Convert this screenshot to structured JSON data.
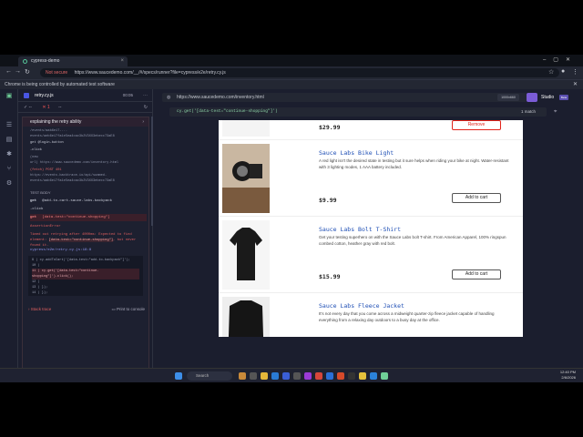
{
  "browser": {
    "tab_title": "cypress-demo",
    "not_secure": "Not secure",
    "url": "https://www.saucedemo.com/__/#/specs/runner?file=cypress/e2e/retry.cy.js",
    "automation_notice": "Chrome is being controlled by automated test software"
  },
  "reporter": {
    "spec_name": "retry.cy.js",
    "duration": "00:05",
    "passed_count": "--",
    "failed_count": "1",
    "pending_count": "--",
    "test_title": "explaining the retry ability",
    "log_lines": [
      "/events/aab6e17-...",
      "events/aeb6e17fa1e5ea4cac3b2V3XX3ebecc73aE8",
      "get   @login-button",
      "-click",
      "(new",
      "url)   https://www.saucedemo.com/inventory.html",
      "(fetch)   POST 401",
      "https://events.backtrace.io/api/summed-",
      "events/aab6e17fa1e5ea4cac3b2V3XX3ebecc73aE8"
    ],
    "test_body_label": "TEST BODY",
    "cmd_get_label": "get",
    "cmd_backpack": "@add-to-cart-sauce-labs-backpack",
    "cmd_click": "-click",
    "cmd_failed": "[data-test=\"continue-shopping\"]",
    "assertion_error": "AssertionError",
    "error_message": "Timed out retrying after 4000ms: Expected to find element:",
    "error_selector": "[data-test=\"continue-shopping\"]",
    "error_tail": ", but never found it.",
    "file_ref": "cypress/e2e/retry.cy.js:18:8",
    "code_lines": [
      "9  |      cy.addToCart('[data-test=\"add-to-backpack\"]');",
      "10 |",
      "11 |      cy.get('[data-test=\"continue-shopping\"]').click();",
      "12 |",
      "13 |    });",
      "14 |  });",
      "15 |"
    ],
    "stack_trace": "Stack trace",
    "print_console": "Print to console"
  },
  "aut": {
    "url": "https://www.saucedemo.com/inventory.html",
    "viewport": "1000x660",
    "studio": "Studio",
    "beta": "Beta",
    "selector": "cy.get('[data-test=\"continue-shopping\"]')",
    "match": "1 match"
  },
  "products": [
    {
      "name": "",
      "desc": "",
      "price": "$29.99",
      "button": "Remove"
    },
    {
      "name": "Sauce Labs Bike Light",
      "desc": "A red light isn't the desired state in testing but it sure helps when riding your bike at night. Water-resistant with 3 lighting modes, 1 AAA battery included.",
      "price": "$9.99",
      "button": "Add to cart"
    },
    {
      "name": "Sauce Labs Bolt T-Shirt",
      "desc": "Get your testing superhero on with the Sauce Labs bolt T-shirt. From American Apparel, 100% ringspun combed cotton, heather gray with red bolt.",
      "price": "$15.99",
      "button": "Add to cart"
    },
    {
      "name": "Sauce Labs Fleece Jacket",
      "desc": "It's not every day that you come across a midweight quarter-zip fleece jacket capable of handling everything from a relaxing day outdoors to a busy day at the office.",
      "price": "",
      "button": ""
    }
  ],
  "taskbar": {
    "search": "Search",
    "time": "12:40 PM",
    "date": "2/6/2026"
  },
  "colors": {
    "accent": "#4956e3",
    "error": "#e15f5f",
    "link": "#1f4fb5",
    "remove": "#e2231a"
  }
}
